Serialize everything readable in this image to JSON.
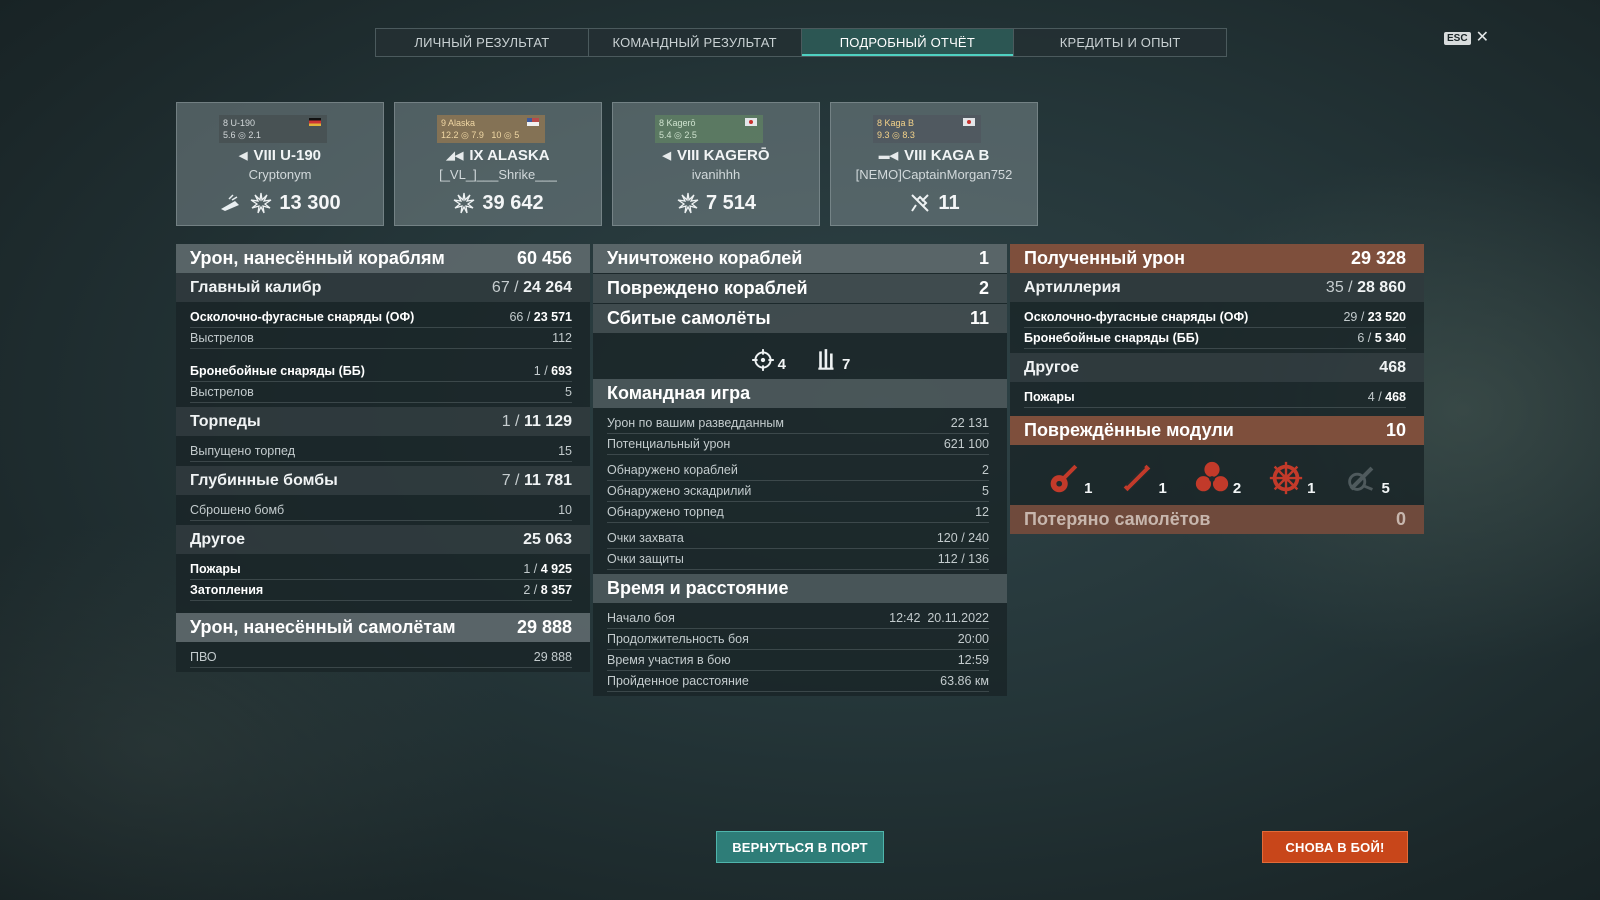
{
  "tabs": [
    {
      "label": "ЛИЧНЫЙ РЕЗУЛЬТАТ"
    },
    {
      "label": "КОМАНДНЫЙ РЕЗУЛЬТАТ"
    },
    {
      "label": "ПОДРОБНЫЙ ОТЧЁТ"
    },
    {
      "label": "КРЕДИТЫ И ОПЫТ"
    }
  ],
  "esc": {
    "key": "ESC",
    "close": "✕"
  },
  "cards": [
    {
      "mini_name": "8 U-190",
      "mini_stats": "5.6 ◎ 2.1",
      "class_icon": "submarine-icon",
      "name": "VIII U-190",
      "player": "Cryptonym",
      "value": "13 300",
      "extra_icon": "torpedo-hit-icon"
    },
    {
      "mini_name": "9 Alaska",
      "mini_stats": "12.2 ◎ 7.9",
      "mini_extra": "10 ◎ 5",
      "class_icon": "cruiser-icon",
      "name": "IX ALASKA",
      "player": "[_VL_]___Shrike___",
      "value": "39 642"
    },
    {
      "mini_name": "8 Kagerō",
      "mini_stats": "5.4 ◎ 2.5",
      "class_icon": "destroyer-icon",
      "name": "VIII KAGERŌ",
      "player": "ivanihhh",
      "value": "7 514"
    },
    {
      "mini_name": "8 Kaga B",
      "mini_stats": "9.3 ◎ 8.3",
      "class_icon": "carrier-icon",
      "name": "VIII KAGA B",
      "player": "[NEMO]CaptainMorgan752",
      "value": "11",
      "extra_icon": "plane-shot-icon"
    }
  ],
  "left": {
    "header": {
      "label": "Урон, нанесённый кораблям",
      "value": "60 456"
    },
    "main_caliber": {
      "label": "Главный калибр",
      "hits": "67",
      "value": "24 264"
    },
    "he": {
      "label": "Осколочно-фугасные снаряды (ОФ)",
      "hits": "66",
      "value": "23 571"
    },
    "he_shots": {
      "label": "Выстрелов",
      "value": "112"
    },
    "ap": {
      "label": "Бронебойные снаряды (ББ)",
      "hits": "1",
      "value": "693"
    },
    "ap_shots": {
      "label": "Выстрелов",
      "value": "5"
    },
    "torpedoes": {
      "label": "Торпеды",
      "hits": "1",
      "value": "11 129"
    },
    "torp_launched": {
      "label": "Выпущено торпед",
      "value": "15"
    },
    "depth": {
      "label": "Глубинные бомбы",
      "hits": "7",
      "value": "11 781"
    },
    "depth_dropped": {
      "label": "Сброшено бомб",
      "value": "10"
    },
    "other": {
      "label": "Другое",
      "value": "25 063"
    },
    "fires": {
      "label": "Пожары",
      "hits": "1",
      "value": "4 925"
    },
    "floods": {
      "label": "Затопления",
      "hits": "2",
      "value": "8 357"
    },
    "planes_header": {
      "label": "Урон, нанесённый самолётам",
      "value": "29 888"
    },
    "aa": {
      "label": "ПВО",
      "value": "29 888"
    }
  },
  "middle": {
    "destroyed": {
      "label": "Уничтожено кораблей",
      "value": "1"
    },
    "damaged": {
      "label": "Повреждено кораблей",
      "value": "2"
    },
    "planes": {
      "label": "Сбитые самолёты",
      "value": "11"
    },
    "plane_icons": [
      {
        "icon": "crosshair-icon",
        "value": "4"
      },
      {
        "icon": "aa-guns-icon",
        "value": "7"
      }
    ],
    "team": {
      "label": "Командная игра"
    },
    "spotting_damage": {
      "label": "Урон по вашим разведданным",
      "value": "22 131"
    },
    "potential": {
      "label": "Потенциальный урон",
      "value": "621 100"
    },
    "spotted_ships": {
      "label": "Обнаружено кораблей",
      "value": "2"
    },
    "spotted_squad": {
      "label": "Обнаружено эскадрилий",
      "value": "5"
    },
    "spotted_torp": {
      "label": "Обнаружено торпед",
      "value": "12"
    },
    "capture": {
      "label": "Очки захвата",
      "value": "120 / 240"
    },
    "defense": {
      "label": "Очки защиты",
      "value": "112 / 136"
    },
    "time": {
      "label": "Время и расстояние"
    },
    "start": {
      "label": "Начало боя",
      "value": "12:42  20.11.2022"
    },
    "duration": {
      "label": "Продолжительность боя",
      "value": "20:00"
    },
    "participation": {
      "label": "Время участия в бою",
      "value": "12:59"
    },
    "distance": {
      "label": "Пройденное расстояние",
      "value": "63.86 км"
    }
  },
  "right": {
    "received": {
      "label": "Полученный урон",
      "value": "29 328"
    },
    "artillery": {
      "label": "Артиллерия",
      "hits": "35",
      "value": "28 860"
    },
    "he": {
      "label": "Осколочно-фугасные снаряды (ОФ)",
      "hits": "29",
      "value": "23 520"
    },
    "ap": {
      "label": "Бронебойные снаряды (ББ)",
      "hits": "6",
      "value": "5 340"
    },
    "other": {
      "label": "Другое",
      "value": "468"
    },
    "fires": {
      "label": "Пожары",
      "hits": "4",
      "value": "468"
    },
    "modules": {
      "label": "Повреждённые модули",
      "value": "10"
    },
    "module_icons": [
      {
        "icon": "guns-icon",
        "value": "1"
      },
      {
        "icon": "torpedo-tubes-icon",
        "value": "1"
      },
      {
        "icon": "propeller-icon",
        "value": "2"
      },
      {
        "icon": "steering-icon",
        "value": "1"
      },
      {
        "icon": "aa-mount-icon",
        "value": "5"
      }
    ],
    "lost_planes": {
      "label": "Потеряно самолётов",
      "value": "0"
    }
  },
  "buttons": {
    "port": "ВЕРНУТЬСЯ В ПОРТ",
    "battle": "СНОВА В БОЙ!"
  },
  "colors": {
    "accent": "#2e7d78",
    "rust": "#7e4f3c",
    "battle": "#c8461a",
    "module_red": "#c23a2a"
  }
}
